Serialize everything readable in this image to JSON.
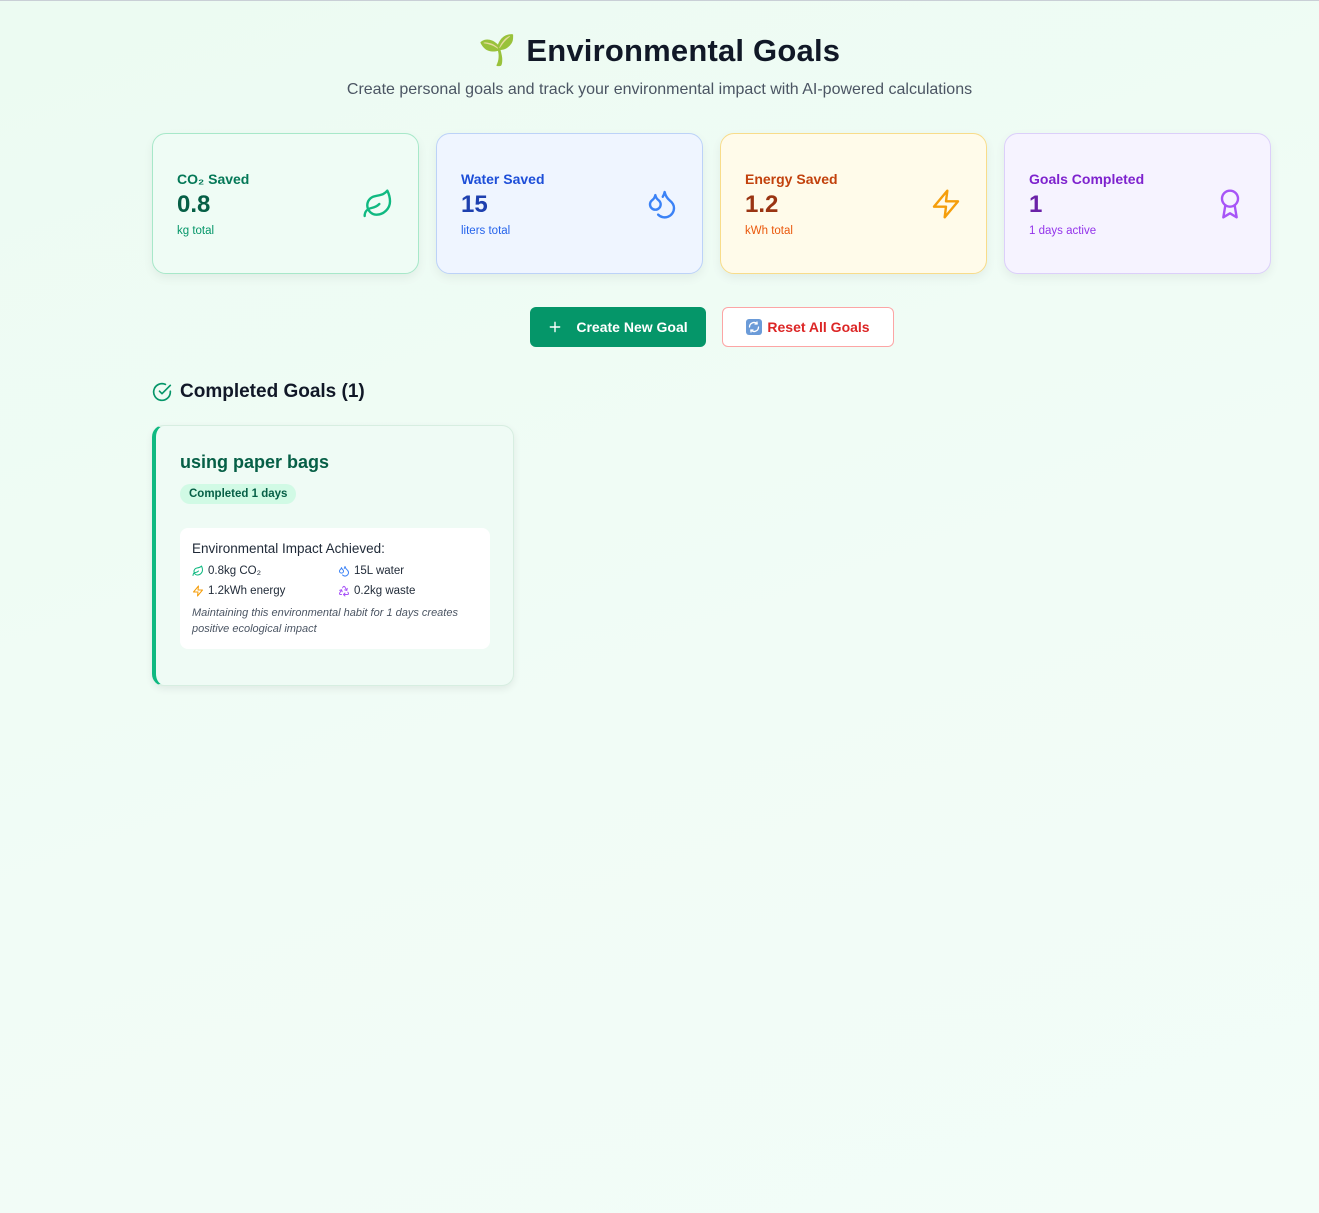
{
  "header": {
    "title": "Environmental Goals",
    "subtitle": "Create personal goals and track your environmental impact with AI-powered calculations",
    "title_icon": "sprout-emoji"
  },
  "stats": [
    {
      "label": "CO₂ Saved",
      "value": "0.8",
      "unit": "kg total",
      "icon": "leaf-icon",
      "accent": "#10b981"
    },
    {
      "label": "Water Saved",
      "value": "15",
      "unit": "liters total",
      "icon": "droplets-icon",
      "accent": "#3b82f6"
    },
    {
      "label": "Energy Saved",
      "value": "1.2",
      "unit": "kWh total",
      "icon": "zap-icon",
      "accent": "#f59e0b"
    },
    {
      "label": "Goals Completed",
      "value": "1",
      "unit": "1 days active",
      "icon": "award-icon",
      "accent": "#a855f7"
    }
  ],
  "actions": {
    "create_label": "Create New Goal",
    "reset_label": "Reset All Goals"
  },
  "completed": {
    "title": "Completed Goals (1)",
    "goals": [
      {
        "name": "using paper bags",
        "badge": "Completed 1 days",
        "impact_title": "Environmental Impact Achieved:",
        "co2": "0.8kg CO₂",
        "water": "15L water",
        "energy": "1.2kWh energy",
        "waste": "0.2kg waste",
        "note": "Maintaining this environmental habit for 1 days creates positive ecological impact"
      }
    ]
  },
  "colors": {
    "primary": "#059669",
    "danger": "#dc2626",
    "background": "#ecfbf2"
  }
}
